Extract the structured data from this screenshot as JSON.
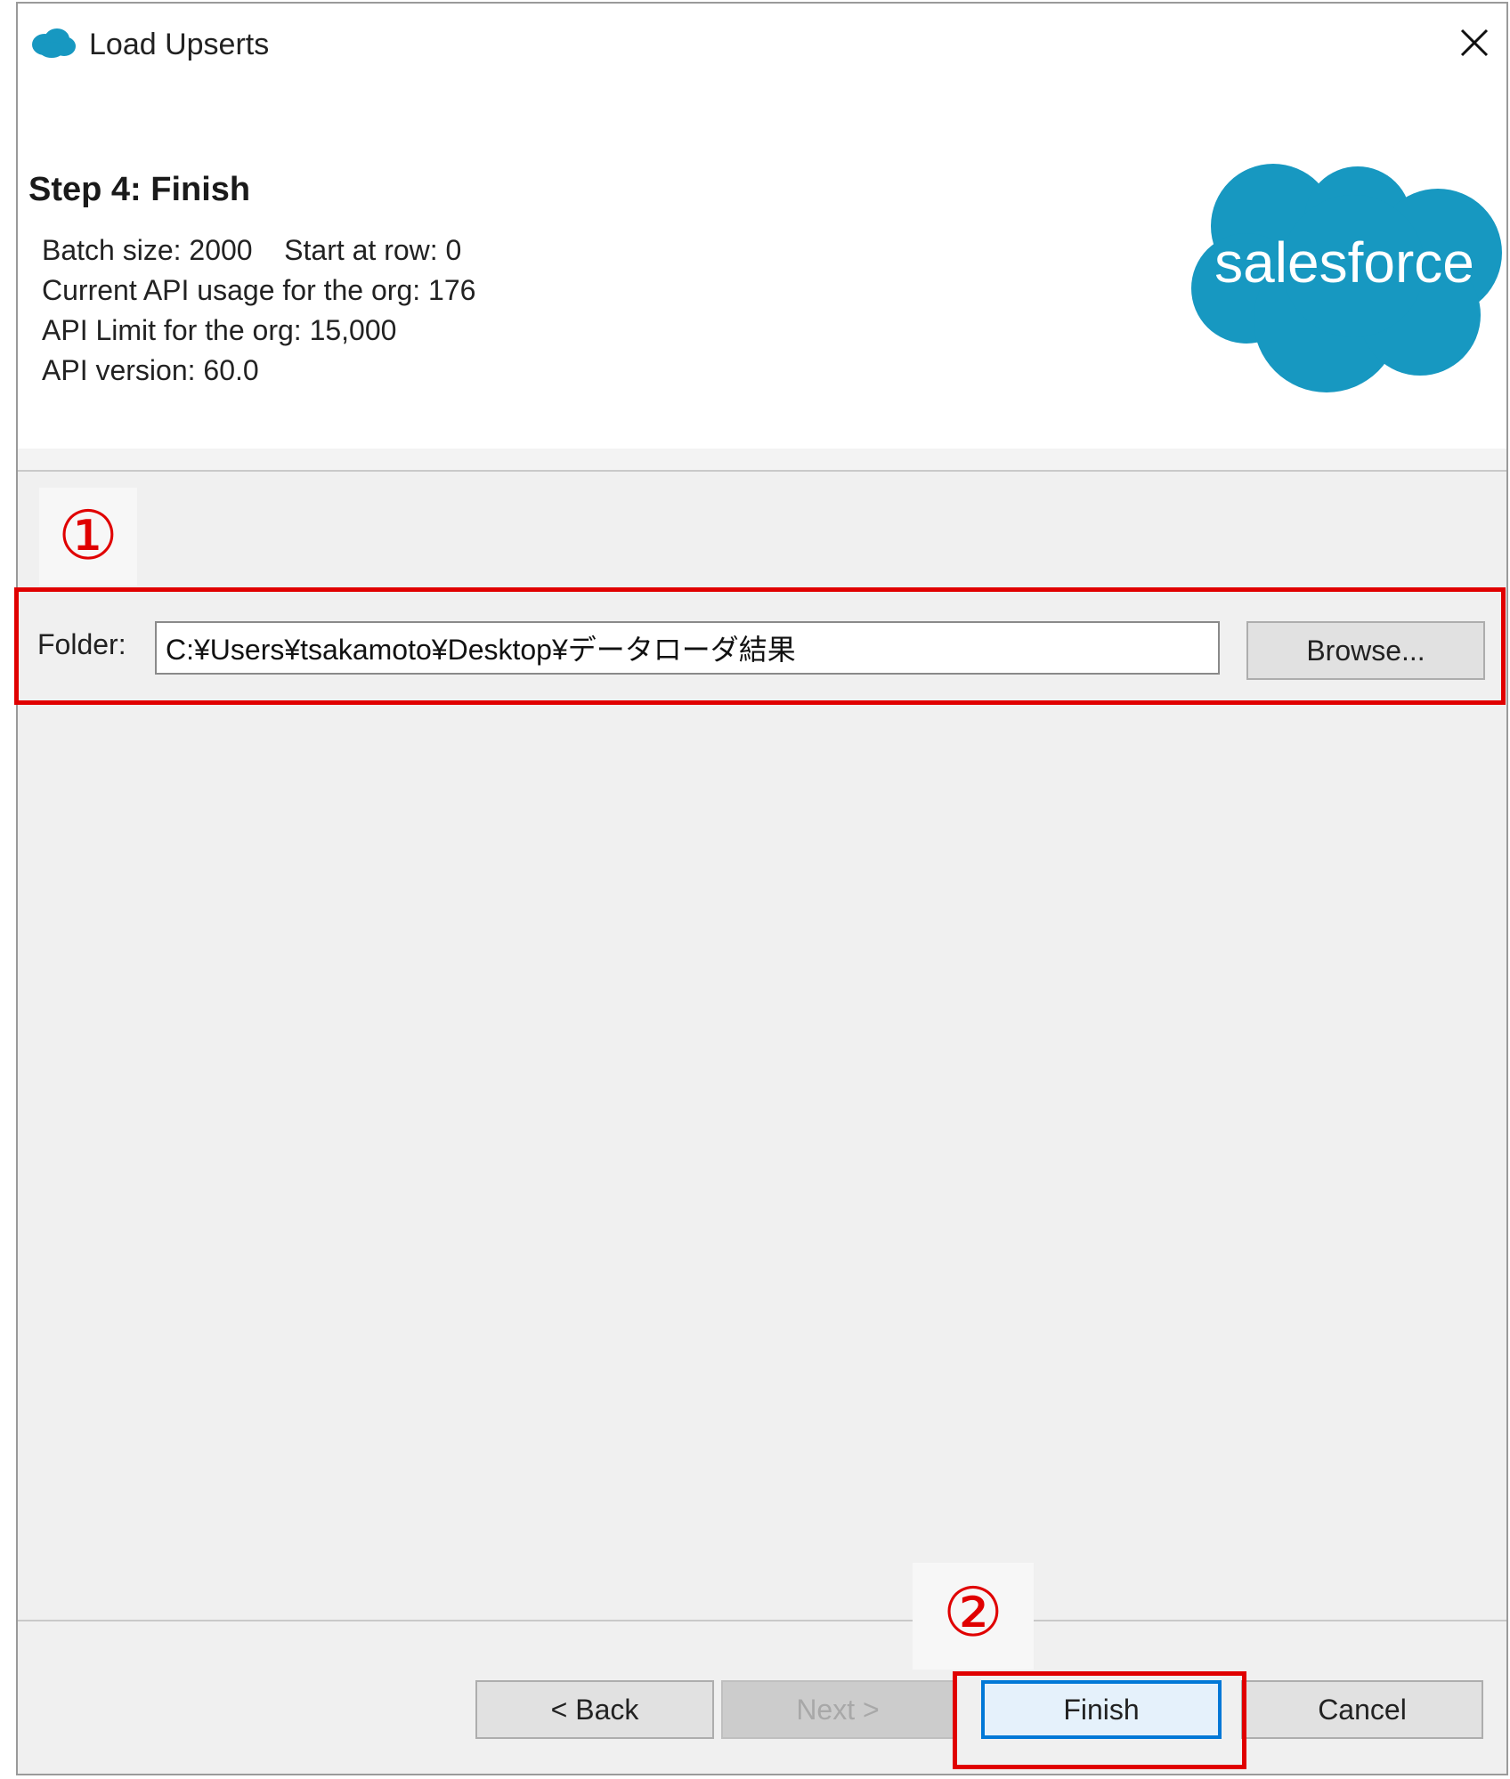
{
  "window": {
    "title": "Load Upserts"
  },
  "header": {
    "step_title": "Step 4: Finish",
    "batch_line": "Batch size: 2000    Start at row: 0",
    "api_usage_line": "Current API usage for the org: 176",
    "api_limit_line": "API Limit for the org: 15,000",
    "api_version_line": "API version: 60.0",
    "brand_name": "salesforce"
  },
  "annotations": {
    "marker_1": "①",
    "marker_2": "②",
    "highlight_color": "#e00000"
  },
  "folder": {
    "label": "Folder:",
    "value": "C:¥Users¥tsakamoto¥Desktop¥データローダ結果",
    "browse_label": "Browse..."
  },
  "buttons": {
    "back": "< Back",
    "next": "Next >",
    "finish": "Finish",
    "cancel": "Cancel"
  },
  "colors": {
    "salesforce_blue": "#1798c1",
    "focus_blue": "#0078d7"
  }
}
